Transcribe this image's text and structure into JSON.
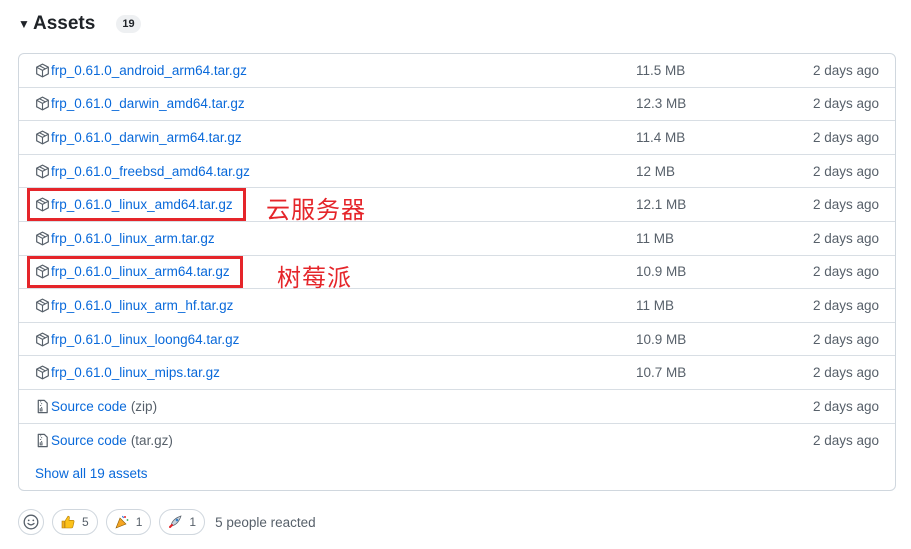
{
  "header": {
    "title": "Assets",
    "count": "19"
  },
  "assets": [
    {
      "name": "frp_0.61.0_android_arm64.tar.gz",
      "suffix": "",
      "size": "11.5 MB",
      "date": "2 days ago",
      "icon": "package-icon"
    },
    {
      "name": "frp_0.61.0_darwin_amd64.tar.gz",
      "suffix": "",
      "size": "12.3 MB",
      "date": "2 days ago",
      "icon": "package-icon"
    },
    {
      "name": "frp_0.61.0_darwin_arm64.tar.gz",
      "suffix": "",
      "size": "11.4 MB",
      "date": "2 days ago",
      "icon": "package-icon"
    },
    {
      "name": "frp_0.61.0_freebsd_amd64.tar.gz",
      "suffix": "",
      "size": "12 MB",
      "date": "2 days ago",
      "icon": "package-icon"
    },
    {
      "name": "frp_0.61.0_linux_amd64.tar.gz",
      "suffix": "",
      "size": "12.1 MB",
      "date": "2 days ago",
      "icon": "package-icon"
    },
    {
      "name": "frp_0.61.0_linux_arm.tar.gz",
      "suffix": "",
      "size": "11 MB",
      "date": "2 days ago",
      "icon": "package-icon"
    },
    {
      "name": "frp_0.61.0_linux_arm64.tar.gz",
      "suffix": "",
      "size": "10.9 MB",
      "date": "2 days ago",
      "icon": "package-icon"
    },
    {
      "name": "frp_0.61.0_linux_arm_hf.tar.gz",
      "suffix": "",
      "size": "11 MB",
      "date": "2 days ago",
      "icon": "package-icon"
    },
    {
      "name": "frp_0.61.0_linux_loong64.tar.gz",
      "suffix": "",
      "size": "10.9 MB",
      "date": "2 days ago",
      "icon": "package-icon"
    },
    {
      "name": "frp_0.61.0_linux_mips.tar.gz",
      "suffix": "",
      "size": "10.7 MB",
      "date": "2 days ago",
      "icon": "package-icon"
    },
    {
      "name": "Source code",
      "suffix": "(zip)",
      "size": "",
      "date": "2 days ago",
      "icon": "file-zip-icon"
    },
    {
      "name": "Source code",
      "suffix": "(tar.gz)",
      "size": "",
      "date": "2 days ago",
      "icon": "file-zip-icon"
    }
  ],
  "show_all_label": "Show all 19 assets",
  "annotations": {
    "cloud_server": "云服务器",
    "raspberry_pi": "树莓派"
  },
  "reactions": {
    "thumbs_up": "5",
    "hooray": "1",
    "rocket": "1",
    "summary": "5 people reacted"
  },
  "colors": {
    "link": "#0969da",
    "muted": "#57606a",
    "border": "#d0d7de",
    "annotation_red": "#e5252a"
  }
}
